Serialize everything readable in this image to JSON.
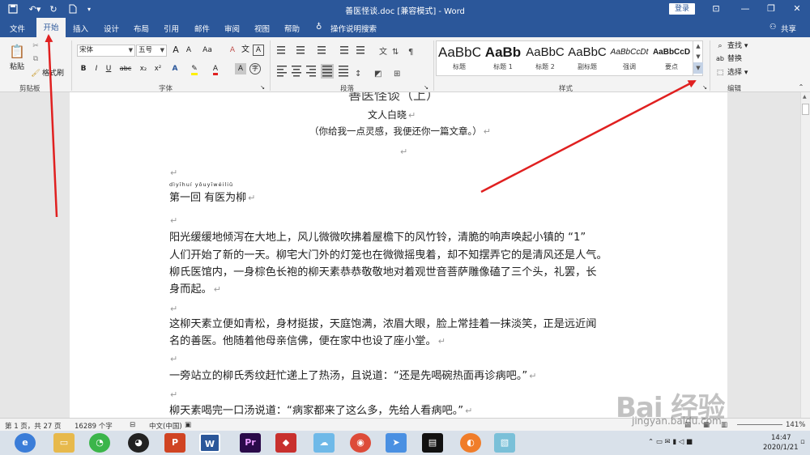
{
  "titlebar": {
    "doc_title": "善医怪谈.doc [兼容模式] - Word",
    "login": "登录",
    "quick_access": {
      "save_icon": "save-icon",
      "undo_icon": "undo-icon",
      "redo_icon": "redo-icon",
      "new_icon": "new-doc-icon"
    },
    "window_controls": {
      "ribbon_icon": "ribbon-display-icon",
      "minimize": "—",
      "maximize": "❐",
      "close": "✕"
    }
  },
  "menu": {
    "tabs": [
      "文件",
      "开始",
      "插入",
      "设计",
      "布局",
      "引用",
      "邮件",
      "审阅",
      "视图",
      "帮助"
    ],
    "active_tab": "开始",
    "tell_me": "操作说明搜索",
    "share": "共享"
  },
  "ribbon": {
    "clipboard": {
      "paste": "粘贴",
      "cut": "✂",
      "copy": "⧉",
      "format_painter": "格式刷",
      "label": "剪贴板"
    },
    "font": {
      "name": "宋体",
      "size": "五号",
      "grow": "A",
      "shrink": "A",
      "case": "Aa",
      "clear": "A",
      "label": "字体",
      "bold": "B",
      "italic": "I",
      "underline": "U",
      "strike": "abc",
      "sub": "x₂",
      "sup": "x²",
      "effects": "A"
    },
    "paragraph": {
      "label": "段落"
    },
    "styles": {
      "label": "样式",
      "items": [
        {
          "preview": "AaBbC",
          "name": "标题"
        },
        {
          "preview": "AaBb",
          "name": "标题 1"
        },
        {
          "preview": "AaBbC",
          "name": "标题 2"
        },
        {
          "preview": "AaBbC",
          "name": "副标题"
        },
        {
          "preview": "AaBbCcDt",
          "name": "强调"
        },
        {
          "preview": "AaBbCcD",
          "name": "要点"
        }
      ]
    },
    "editing": {
      "find": "查找",
      "replace": "替换",
      "select": "选择",
      "label": "编辑"
    }
  },
  "document": {
    "author": "文人白晓",
    "subtitle": "（你给我一点灵感，我便还你一篇文章。）",
    "pinyin": "dìyīhuí yǒuyīwéiliǔ",
    "chapter": "第一回  有医为柳",
    "paragraphs": [
      "阳光缓缓地倾泻在大地上，风儿微微吹拂着屋檐下的风竹铃，清脆的响声唤起小镇的 “1”",
      "人们开始了新的一天。柳宅大门外的灯笼也在微微摇曳着，却不知摆弄它的是清风还是人气。",
      "柳氏医馆内，一身棕色长袍的柳天素恭恭敬敬地对着观世音菩萨雕像磕了三个头，礼罢，长",
      "身而起。",
      "这柳天素立便如青松，身材挺拔，天庭饱满，浓眉大眼，脸上常挂着一抹淡笑，正是远近闻",
      "名的善医。他随着他母亲信佛，便在家中也设了座小堂。",
      "一旁站立的柳氏秀纹赶忙递上了热汤，且说道：“还是先喝碗热面再诊病吧。”",
      "柳天素喝完一口汤说道：“病家都来了这么多，先给人看病吧。”"
    ],
    "para_mark": "↵"
  },
  "status": {
    "page": "第 1 页，共 27 页",
    "words": "16289 个字",
    "lang": "中文(中国)",
    "zoom": "141%"
  },
  "taskbar": {
    "time": "14:47",
    "date": "2020/1/21"
  },
  "watermark": {
    "text": "Bai 经验",
    "url": "jingyan.baidu.com"
  },
  "colors": {
    "accent": "#2b579a",
    "arrow": "#e02020"
  }
}
